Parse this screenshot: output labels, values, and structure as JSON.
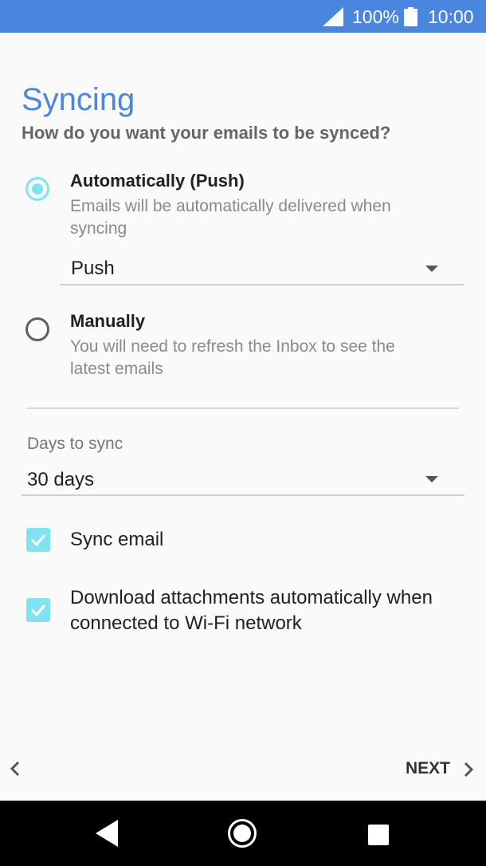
{
  "status_bar": {
    "battery_text": "100%",
    "time": "10:00",
    "signal_icon": "signal-icon",
    "battery_icon": "battery-icon"
  },
  "page": {
    "title": "Syncing",
    "subtitle": "How do you want your emails to be synced?"
  },
  "sync_options": [
    {
      "title": "Automatically (Push)",
      "description": "Emails will be automatically delivered when syncing",
      "selected": true
    },
    {
      "title": "Manually",
      "description": "You will need to refresh the Inbox to see the latest emails",
      "selected": false
    }
  ],
  "push_dropdown": {
    "value": "Push"
  },
  "days_to_sync": {
    "label": "Days to sync",
    "value": "30 days"
  },
  "checkboxes": [
    {
      "label": "Sync email",
      "checked": true
    },
    {
      "label": "Download attachments automatically when connected to Wi-Fi network",
      "checked": true
    }
  ],
  "footer": {
    "next_label": "NEXT"
  },
  "colors": {
    "accent": "#4a86e0",
    "status_bar": "#4a86e0",
    "checked": "#7fe3f1",
    "nav_bar": "#000000"
  }
}
